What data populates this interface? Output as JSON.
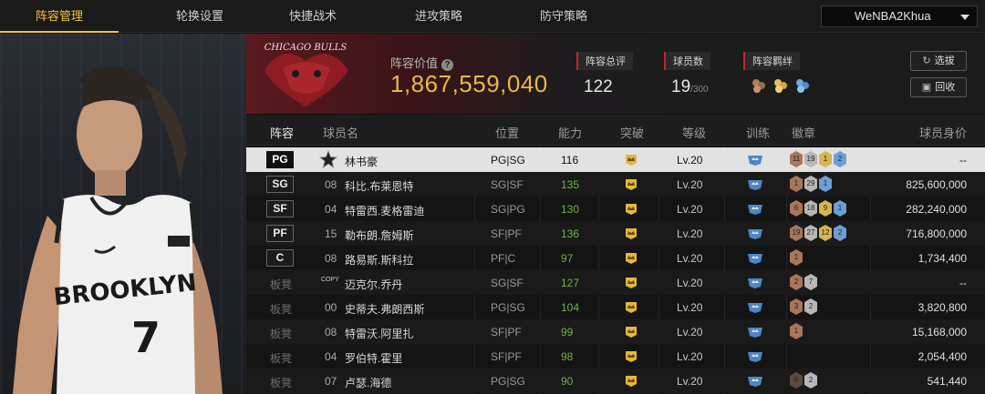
{
  "nav": {
    "tabs": [
      {
        "label": "阵容管理",
        "active": true
      },
      {
        "label": "轮换设置",
        "active": false
      },
      {
        "label": "快捷战术",
        "active": false
      },
      {
        "label": "进攻策略",
        "active": false
      },
      {
        "label": "防守策略",
        "active": false
      }
    ],
    "account": "WeNBA2Khua"
  },
  "summary": {
    "value_label": "阵容价值",
    "value": "1,867,559,040",
    "overall_label": "阵容总评",
    "overall": "122",
    "count_label": "球员数",
    "count": "19",
    "count_max": "/300",
    "bond_label": "阵容羁绊",
    "select_button": "选拔",
    "recycle_button": "回收",
    "logo_text": "CHICAGO BULLS"
  },
  "table": {
    "headers": [
      "阵容",
      "球员名",
      "位置",
      "能力",
      "突破",
      "等级",
      "训练",
      "徽章",
      "球员身价"
    ],
    "rows": [
      {
        "slot": "PG",
        "starter": true,
        "num": "",
        "name": "林书豪",
        "position": "PG|SG",
        "rating": "116",
        "level": "Lv.20",
        "badges": [
          [
            "11",
            "b-bronze"
          ],
          [
            "19",
            "b-silver"
          ],
          [
            "1",
            "b-gold"
          ],
          [
            "2",
            "b-blue"
          ]
        ],
        "price": "--",
        "selected": true
      },
      {
        "slot": "SG",
        "starter": true,
        "num": "08",
        "name": "科比.布莱恩特",
        "position": "SG|SF",
        "rating": "135",
        "level": "Lv.20",
        "badges": [
          [
            "1",
            "b-bronze"
          ],
          [
            "29",
            "b-silver"
          ],
          [
            "1",
            "b-blue"
          ]
        ],
        "price": "825,600,000"
      },
      {
        "slot": "SF",
        "starter": true,
        "num": "04",
        "name": "特雷西.麦格雷迪",
        "position": "SG|PG",
        "rating": "130",
        "level": "Lv.20",
        "badges": [
          [
            "6",
            "b-bronze"
          ],
          [
            "18",
            "b-silver"
          ],
          [
            "9",
            "b-gold"
          ],
          [
            "1",
            "b-blue"
          ]
        ],
        "price": "282,240,000"
      },
      {
        "slot": "PF",
        "starter": true,
        "num": "15",
        "name": "勒布朗.詹姆斯",
        "position": "SF|PF",
        "rating": "136",
        "level": "Lv.20",
        "badges": [
          [
            "19",
            "b-bronze"
          ],
          [
            "27",
            "b-silver"
          ],
          [
            "12",
            "b-gold"
          ],
          [
            "2",
            "b-blue"
          ]
        ],
        "price": "716,800,000"
      },
      {
        "slot": "C",
        "starter": true,
        "num": "08",
        "name": "路易斯.斯科拉",
        "position": "PF|C",
        "rating": "97",
        "level": "Lv.20",
        "badges": [
          [
            "1",
            "b-bronze"
          ]
        ],
        "price": "1,734,400"
      },
      {
        "slot": "板凳",
        "starter": false,
        "num": "COPY",
        "name": "迈克尔.乔丹",
        "position": "SG|SF",
        "rating": "127",
        "level": "Lv.20",
        "badges": [
          [
            "2",
            "b-bronze"
          ],
          [
            "7",
            "b-silver"
          ]
        ],
        "price": "--"
      },
      {
        "slot": "板凳",
        "starter": false,
        "num": "00",
        "name": "史蒂夫.弗朗西斯",
        "position": "PG|SG",
        "rating": "104",
        "level": "Lv.20",
        "badges": [
          [
            "3",
            "b-bronze"
          ],
          [
            "2",
            "b-silver"
          ]
        ],
        "price": "3,820,800"
      },
      {
        "slot": "板凳",
        "starter": false,
        "num": "08",
        "name": "特雷沃.阿里扎",
        "position": "SF|PF",
        "rating": "99",
        "level": "Lv.20",
        "badges": [
          [
            "1",
            "b-bronze"
          ]
        ],
        "price": "15,168,000"
      },
      {
        "slot": "板凳",
        "starter": false,
        "num": "04",
        "name": "罗伯特.霍里",
        "position": "SF|PF",
        "rating": "98",
        "level": "Lv.20",
        "badges": [],
        "price": "2,054,400"
      },
      {
        "slot": "板凳",
        "starter": false,
        "num": "07",
        "name": "卢瑟.海德",
        "position": "PG|SG",
        "rating": "90",
        "level": "Lv.20",
        "badges": [
          [
            "6",
            "b-dark"
          ],
          [
            "2",
            "b-silver"
          ]
        ],
        "price": "541,440"
      }
    ]
  },
  "player_art": {
    "team_text": "BROOKLYN",
    "number": "7"
  },
  "colors": {
    "accent": "#f5c242",
    "gold_value": "#e8b84a",
    "rating_green": "#6fb24a",
    "bulls_red": "#c8242c"
  }
}
